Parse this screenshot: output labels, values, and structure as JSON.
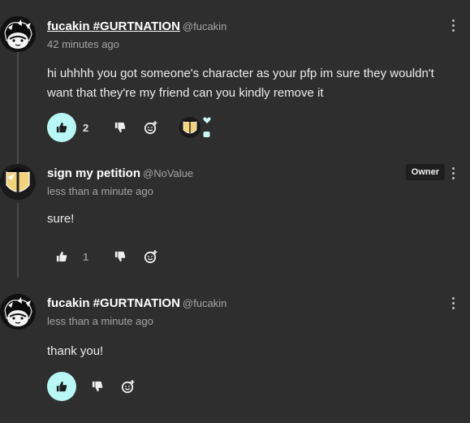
{
  "comments": [
    {
      "author": "fucakin #GURTNATION",
      "handle": "@fucakin",
      "time": "42 minutes ago",
      "text": "hi uhhhh you got someone's character as your pfp im sure they wouldn't want that they're my friend can you kindly remove it",
      "likes": "2",
      "liked": true
    },
    {
      "author": "sign my petition",
      "handle": "@NoValue",
      "badge": "Owner",
      "time": "less than a minute ago",
      "text": "sure!",
      "likes": "1",
      "liked": false
    },
    {
      "author": "fucakin #GURTNATION",
      "handle": "@fucakin",
      "time": "less than a minute ago",
      "text": "thank you!",
      "likes": "",
      "liked": true
    }
  ],
  "colors": {
    "background": "#2f2e2f",
    "like_active": "#b8f7f5",
    "owner_badge": "#1e1e1e"
  },
  "icons": [
    "thumbs-up-icon",
    "thumbs-down-icon",
    "add-reaction-icon",
    "more-options-icon"
  ]
}
